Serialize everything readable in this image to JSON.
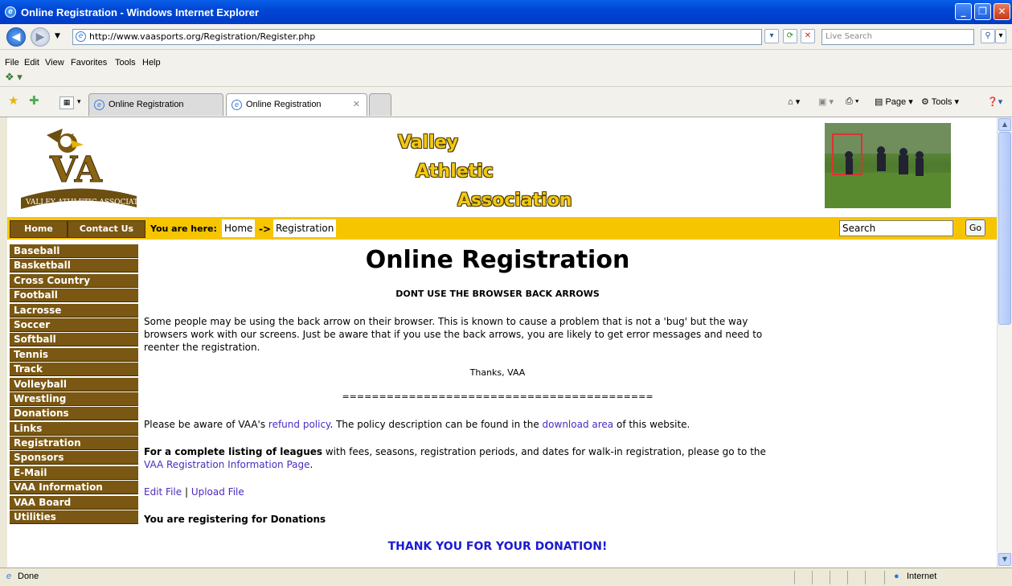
{
  "window": {
    "title": "Online Registration - Windows Internet Explorer"
  },
  "address_bar": {
    "url": "http://www.vaasports.org/Registration/Register.php",
    "search_placeholder": "Live Search"
  },
  "menu": {
    "items": [
      "File",
      "Edit",
      "View",
      "Favorites",
      "Tools",
      "Help"
    ]
  },
  "tabs": [
    {
      "label": "Online Registration"
    },
    {
      "label": "Online Registration"
    }
  ],
  "command_bar": {
    "page": "Page",
    "tools": "Tools"
  },
  "site": {
    "logo_text": "VALLEY ATHLETIC ASSOCIATION",
    "logo_initials": "VA",
    "brand_lines": [
      "Valley",
      "Athletic",
      "Association"
    ]
  },
  "nav": {
    "home": "Home",
    "contact": "Contact Us",
    "you_are_here": "You are here:",
    "crumbs": [
      "Home",
      "Registration"
    ],
    "arrow": "->",
    "search_value": "Search",
    "go": "Go"
  },
  "sidebar": {
    "items": [
      "Baseball",
      "Basketball",
      "Cross Country",
      "Football",
      "Lacrosse",
      "Soccer",
      "Softball",
      "Tennis",
      "Track",
      "Volleyball",
      "Wrestling",
      "Donations",
      "Links",
      "Registration",
      "Sponsors",
      "E-Mail",
      "VAA Information",
      "VAA Board",
      "Utilities"
    ]
  },
  "content": {
    "title": "Online Registration",
    "warning": "DONT USE THE BROWSER BACK ARROWS",
    "para1_l1": "Some people may be using the back arrow on their browser. This is known to cause a problem that is not a 'bug' but the way",
    "para1_l2": "browsers work with our screens. Just be aware that if you use the back arrows, you are likely to get error messages and need to",
    "para1_l3": "reenter the registration.",
    "thanks": "Thanks, VAA",
    "divider": "==========================================",
    "refund_pre": "Please be aware of VAA's ",
    "refund_link": "refund policy",
    "refund_mid": ". The policy description can be found in the ",
    "download_link": "download area",
    "refund_post": " of this website.",
    "leagues_bold": "For a complete listing of leagues",
    "leagues_rest": " with fees, seasons, registration periods, and dates for walk-in registration, please go to the",
    "leagues_link": "VAA Registration Information Page",
    "leagues_end": ".",
    "edit_file": "Edit File",
    "pipe": " | ",
    "upload_file": "Upload File",
    "registering": "You are registering for Donations",
    "thank_you": "THANK YOU FOR YOUR DONATION!"
  },
  "status": {
    "left": "Done",
    "zone": "Internet"
  }
}
